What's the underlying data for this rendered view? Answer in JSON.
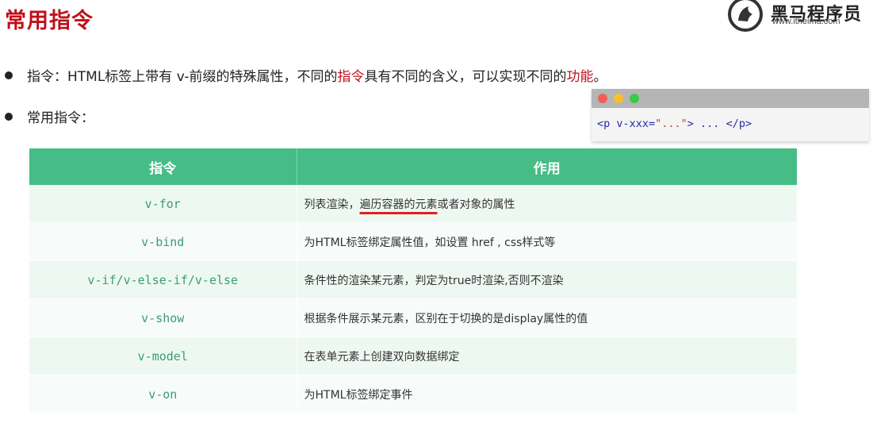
{
  "page": {
    "title": "常用指令"
  },
  "logo": {
    "name": "黑马程序员",
    "url": "www.itheima.com"
  },
  "bullets": {
    "b1": {
      "part1": "指令：HTML标签上带有 v-前缀的特殊属性，不同的",
      "hl1": "指令",
      "part2": "具有不同的含义，可以实现不同的",
      "hl2": "功能",
      "part3": "。"
    },
    "b2": "常用指令："
  },
  "code": {
    "tag_open": "<p v-xxx=",
    "attr_val": "\"...\"",
    "rest": "> ... </p>"
  },
  "table": {
    "headers": [
      "指令",
      "作用"
    ],
    "rows": [
      {
        "directive": "v-for",
        "use_pre": "列表渲染，",
        "use_hl": "遍历容器的元素",
        "use_post": "或者对象的属性"
      },
      {
        "directive": "v-bind",
        "use": "为HTML标签绑定属性值，如设置 href , css样式等"
      },
      {
        "directive": "v-if/v-else-if/v-else",
        "use": "条件性的渲染某元素，判定为true时渲染,否则不渲染"
      },
      {
        "directive": "v-show",
        "use": "根据条件展示某元素，区别在于切换的是display属性的值"
      },
      {
        "directive": "v-model",
        "use": "在表单元素上创建双向数据绑定"
      },
      {
        "directive": "v-on",
        "use": "为HTML标签绑定事件"
      }
    ]
  },
  "colors": {
    "title_red": "#c0101a",
    "header_green": "#46bd86",
    "directive_text": "#3a9c7a",
    "underline_red": "#e02020"
  }
}
